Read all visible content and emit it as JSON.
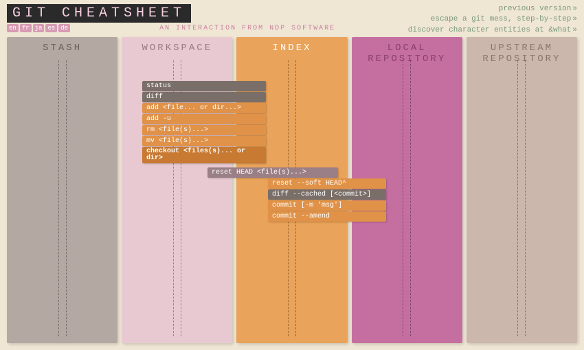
{
  "header": {
    "title": "GIT CHEATSHEET",
    "subtitle": "AN INTERACTION FROM NDP SOFTWARE",
    "langs": [
      "en",
      "fr",
      "ja",
      "es",
      "de"
    ]
  },
  "links": {
    "l1": "previous version",
    "l2": "escape a git mess, step-by-step",
    "l3": "discover character entities at &what"
  },
  "columns": {
    "c0": "STASH",
    "c1": "WORKSPACE",
    "c2": "INDEX",
    "c3": "LOCAL REPOSITORY",
    "c4": "UPSTREAM REPOSITORY"
  },
  "cmds": {
    "status": "status",
    "diff": "diff",
    "add_file": "add <file... or dir...>",
    "add_u": "add -u",
    "rm": "rm <file(s)...>",
    "mv": "mv <file(s)...>",
    "checkout": "checkout <files(s)... or dir>",
    "reset_head": "reset HEAD <file(s)...>",
    "reset_soft": "reset --soft HEAD^",
    "diff_cached": "diff --cached [<commit>]",
    "commit": "commit [-m 'msg']",
    "commit_amend": "commit --amend"
  }
}
